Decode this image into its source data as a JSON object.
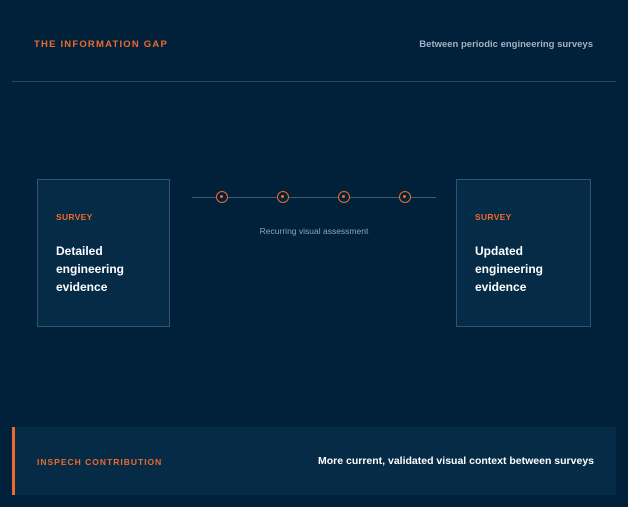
{
  "header": {
    "title": "THE INFORMATION GAP",
    "subtitle": "Between periodic engineering surveys"
  },
  "left_survey": {
    "tag": "SURVEY",
    "text": "Detailed engineering evidence"
  },
  "timeline": {
    "label": "Recurring visual assessment",
    "dot_count": 4,
    "icon": "target-dot-icon"
  },
  "right_survey": {
    "tag": "SURVEY",
    "text": "Updated engineering evidence"
  },
  "footer": {
    "label": "INSPECH CONTRIBUTION",
    "text": "More current, validated visual context between surveys"
  },
  "colors": {
    "background": "#01203a",
    "panel": "#052b47",
    "accent": "#ee6a2c",
    "muted_text": "#9fb2c3",
    "text": "#ffffff"
  }
}
